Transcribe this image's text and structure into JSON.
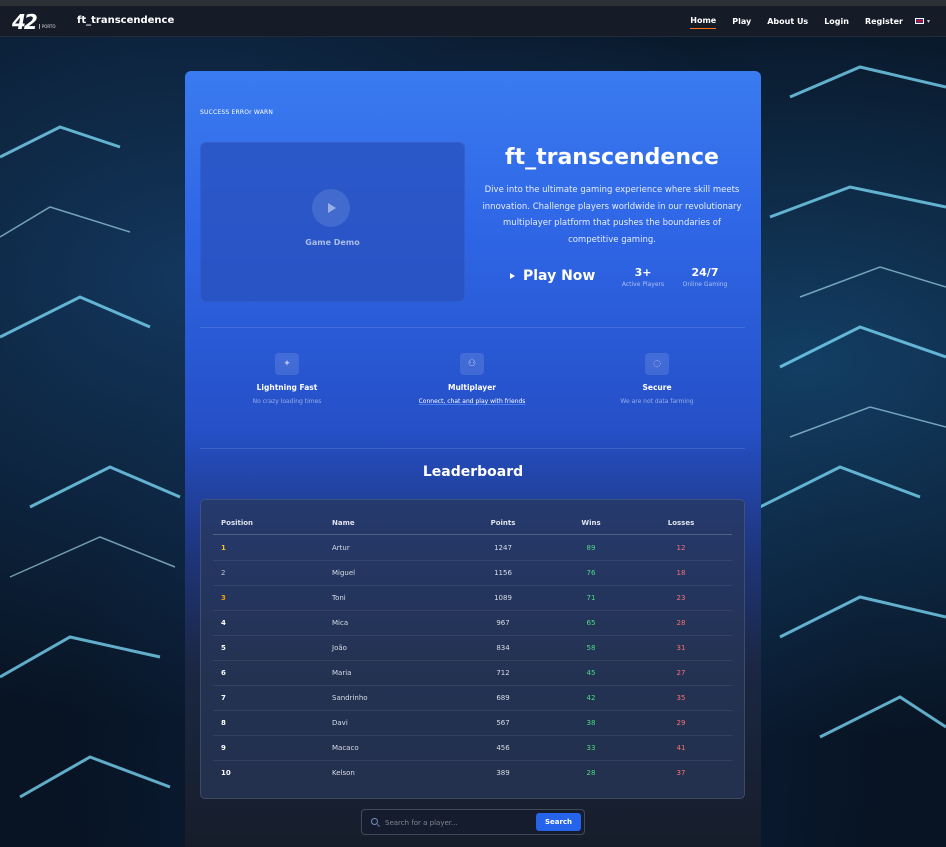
{
  "navbar": {
    "logo_text": "42",
    "logo_sub": "PORTO",
    "brand": "ft_transcendence",
    "links": [
      "Home",
      "Play",
      "About Us",
      "Login",
      "Register"
    ],
    "active_link": "Home",
    "language": "en"
  },
  "status_text": "SUCCESS ERROr WARN",
  "demo": {
    "label": "Game Demo"
  },
  "hero": {
    "title": "ft_transcendence",
    "description": "Dive into the ultimate gaming experience where skill meets innovation. Challenge players worldwide in our revolutionary multiplayer platform that pushes the boundaries of competitive gaming.",
    "play_label": "Play Now",
    "stats": [
      {
        "value": "3+",
        "label": "Active Players"
      },
      {
        "value": "24/7",
        "label": "Online Gaming"
      }
    ]
  },
  "features": [
    {
      "icon": "lightning-icon",
      "title": "Lightning Fast",
      "subtitle": "No crazy loading times"
    },
    {
      "icon": "users-icon",
      "title": "Multiplayer",
      "subtitle": "Connect, chat and play with friends"
    },
    {
      "icon": "shield-icon",
      "title": "Secure",
      "subtitle": "We are not data farming"
    }
  ],
  "leaderboard": {
    "title": "Leaderboard",
    "columns": [
      "Position",
      "Name",
      "Points",
      "Wins",
      "Losses"
    ],
    "rows": [
      {
        "position": "1",
        "name": "Artur",
        "points": "1247",
        "wins": "89",
        "losses": "12"
      },
      {
        "position": "2",
        "name": "Miguel",
        "points": "1156",
        "wins": "76",
        "losses": "18"
      },
      {
        "position": "3",
        "name": "Toni",
        "points": "1089",
        "wins": "71",
        "losses": "23"
      },
      {
        "position": "4",
        "name": "Mica",
        "points": "967",
        "wins": "65",
        "losses": "28"
      },
      {
        "position": "5",
        "name": "João",
        "points": "834",
        "wins": "58",
        "losses": "31"
      },
      {
        "position": "6",
        "name": "Maria",
        "points": "712",
        "wins": "45",
        "losses": "27"
      },
      {
        "position": "7",
        "name": "Sandrinho",
        "points": "689",
        "wins": "42",
        "losses": "35"
      },
      {
        "position": "8",
        "name": "Davi",
        "points": "567",
        "wins": "38",
        "losses": "29"
      },
      {
        "position": "9",
        "name": "Macaco",
        "points": "456",
        "wins": "33",
        "losses": "41"
      },
      {
        "position": "10",
        "name": "Kelson",
        "points": "389",
        "wins": "28",
        "losses": "37"
      }
    ]
  },
  "search": {
    "placeholder": "Search for a player...",
    "button_label": "Search"
  },
  "colors": {
    "accent": "#2563eb",
    "active_underline": "#f97316",
    "wins": "#4ade80",
    "losses": "#f87171",
    "gold": "#fbbf24"
  }
}
